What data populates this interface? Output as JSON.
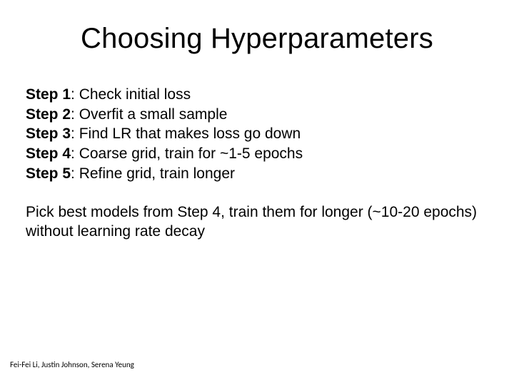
{
  "title": "Choosing Hyperparameters",
  "steps": [
    {
      "label": "Step 1",
      "text": ": Check initial loss"
    },
    {
      "label": "Step 2",
      "text": ": Overfit a small sample"
    },
    {
      "label": "Step 3",
      "text": ": Find LR that makes loss go down"
    },
    {
      "label": "Step 4",
      "text": ": Coarse grid, train for ~1-5 epochs"
    },
    {
      "label": "Step 5",
      "text": ": Refine grid, train longer"
    }
  ],
  "note": "Pick best models from Step 4, train them for longer (~10-20 epochs) without learning rate decay",
  "credit": "Fei-Fei Li, Justin Johnson, Serena Yeung"
}
